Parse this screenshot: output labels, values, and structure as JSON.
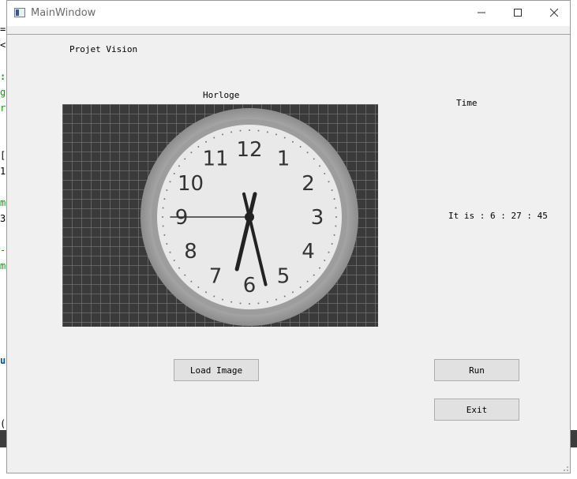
{
  "window": {
    "title": "MainWindow"
  },
  "controls": {
    "minimize": "—",
    "maximize": "☐",
    "close": "✕"
  },
  "labels": {
    "project": "Projet Vision",
    "image_title": "Horloge",
    "time_title": "Time",
    "result": "It is : 6 : 27 : 45"
  },
  "buttons": {
    "load": "Load Image",
    "run": "Run",
    "exit": "Exit"
  },
  "clock": {
    "hours": 6,
    "minutes": 27,
    "seconds": 45,
    "numerals": [
      "12",
      "1",
      "2",
      "3",
      "4",
      "5",
      "6",
      "7",
      "8",
      "9",
      "10",
      "11"
    ]
  },
  "colors": {
    "window_bg": "#f0f0f0",
    "button_bg": "#e1e1e1",
    "button_border": "#adadad"
  }
}
